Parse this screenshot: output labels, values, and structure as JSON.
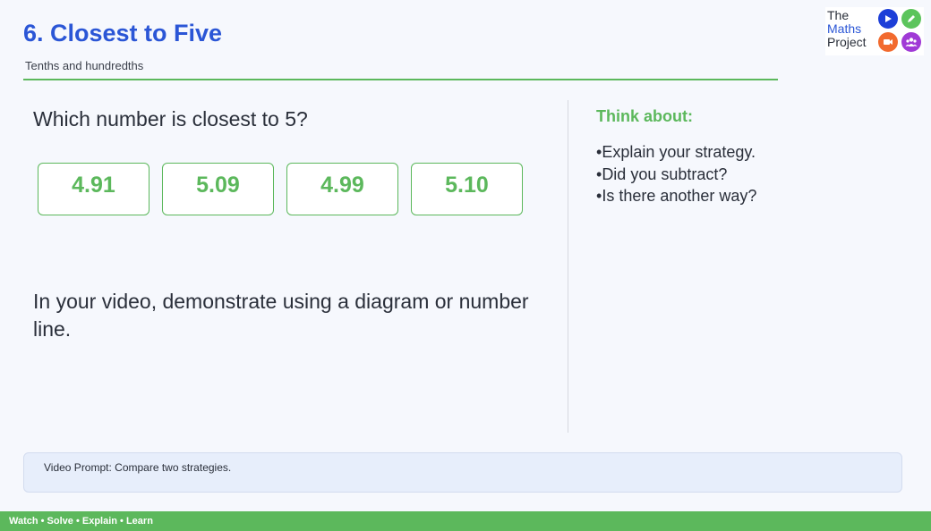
{
  "header": {
    "title": "6. Closest to Five",
    "subtitle": "Tenths and hundredths"
  },
  "logo": {
    "line1": "The",
    "line2": "Maths",
    "line3": "Project",
    "icons": [
      "play-icon",
      "pencil-icon",
      "video-camera-icon",
      "people-icon"
    ],
    "colors": [
      "#1d3fd8",
      "#5cc45c",
      "#f26a2e",
      "#a03ad6"
    ]
  },
  "question": {
    "text": "Which number is closest to 5?",
    "options": [
      "4.91",
      "5.09",
      "4.99",
      "5.10"
    ]
  },
  "instruction": "In your video, demonstrate using a diagram or number line.",
  "think": {
    "heading": "Think about:",
    "items": [
      "Explain your strategy.",
      "Did you subtract?",
      "Is there another way?"
    ]
  },
  "prompt": "Video Prompt: Compare two strategies.",
  "footer": "Watch • Solve • Explain • Learn",
  "theme": {
    "title_color": "#2b56d6",
    "accent_green": "#5cb85c",
    "prompt_bg": "#e7eefb"
  }
}
